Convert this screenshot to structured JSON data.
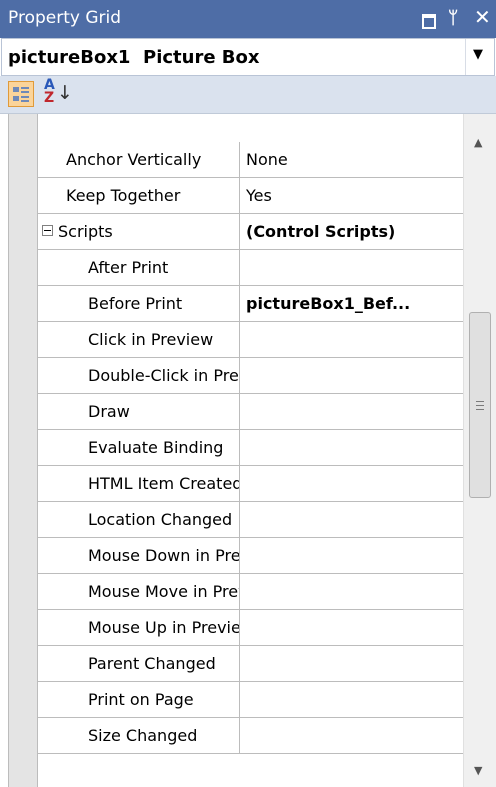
{
  "panel": {
    "title": "Property Grid",
    "selector": {
      "object_name": "pictureBox1",
      "object_type": "Picture Box"
    }
  },
  "toolbar": {
    "categorized_icon": "categorized-icon",
    "alphabetical_icon": "sort-az-icon"
  },
  "rows": [
    {
      "name": "Anchor Vertically",
      "value": "None"
    },
    {
      "name": "Keep Together",
      "value": "Yes"
    },
    {
      "name": "Scripts",
      "value": "(Control Scripts)",
      "category": true,
      "expanded": true
    },
    {
      "name": "After Print",
      "value": ""
    },
    {
      "name": "Before Print",
      "value": "pictureBox1_Bef..."
    },
    {
      "name": "Click in Preview",
      "value": ""
    },
    {
      "name": "Double-Click in Preview",
      "value": ""
    },
    {
      "name": "Draw",
      "value": ""
    },
    {
      "name": "Evaluate Binding",
      "value": ""
    },
    {
      "name": "HTML Item Created",
      "value": ""
    },
    {
      "name": "Location Changed",
      "value": ""
    },
    {
      "name": "Mouse Down in Preview",
      "value": ""
    },
    {
      "name": "Mouse Move in Preview",
      "value": ""
    },
    {
      "name": "Mouse Up in Preview",
      "value": ""
    },
    {
      "name": "Parent Changed",
      "value": ""
    },
    {
      "name": "Print on Page",
      "value": ""
    },
    {
      "name": "Size Changed",
      "value": ""
    }
  ],
  "colors": {
    "titlebar": "#4e6da6",
    "toolbar": "#dae2ee",
    "grid_lines": "#bcbcbc"
  }
}
